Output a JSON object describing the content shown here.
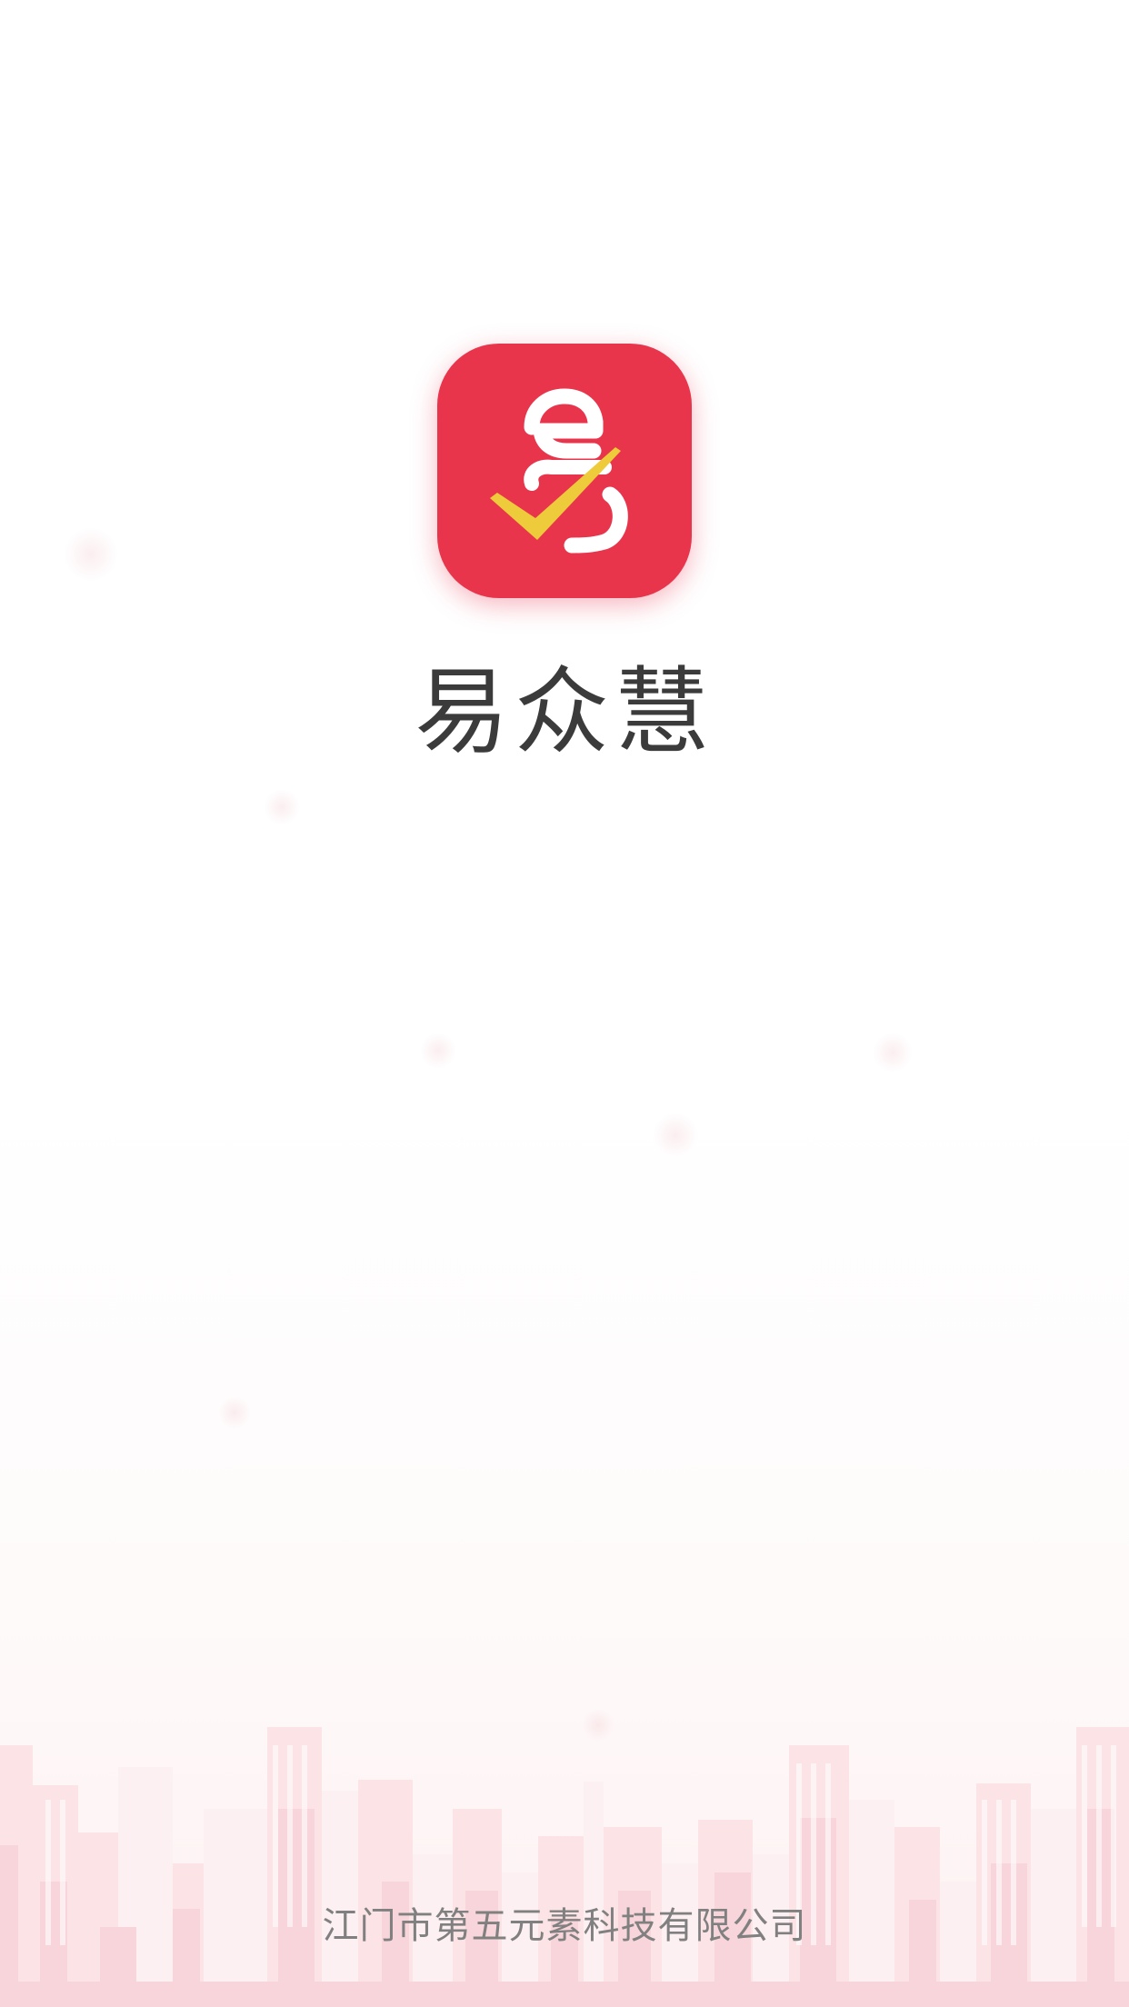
{
  "app": {
    "name": "易众慧",
    "logo_icon": "yi-checkmark-logo-icon",
    "brand_color": "#e8354c",
    "accent_color": "#eecb3a"
  },
  "footer": {
    "company": "江门市第五元素科技有限公司"
  },
  "background": {
    "illustration": "city-skyline-illustration",
    "tint_color": "#f5c9cf"
  }
}
